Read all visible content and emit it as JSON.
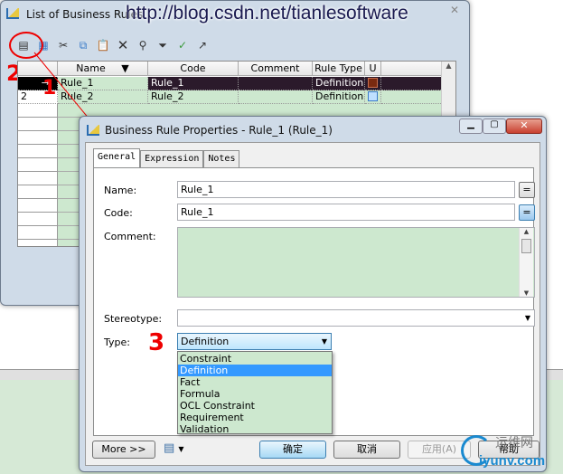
{
  "watermark": "http://blog.csdn.net/tianlesoftware",
  "watermark2": {
    "cn": "运维网",
    "url": "iyunv.com"
  },
  "annotations": [
    "2",
    "1",
    "3"
  ],
  "list_window": {
    "title": "List of Business Rules",
    "toolbar": [
      "properties-icon",
      "add-rows-icon",
      "cut-icon",
      "copy-icon",
      "paste-icon",
      "delete-icon",
      "find-icon",
      "filter-icon",
      "filter-check-icon",
      "shortcut-icon"
    ],
    "columns": [
      "Name",
      "Code",
      "Comment",
      "Rule Type",
      "U"
    ],
    "rows": [
      {
        "marker": "→",
        "name": "Rule_1",
        "code": "Rule_1",
        "comment": "",
        "rule_type": "Definition",
        "selected": true
      },
      {
        "marker": "2",
        "name": "Rule_2",
        "code": "Rule_2",
        "comment": "",
        "rule_type": "Definition",
        "selected": false
      }
    ]
  },
  "dialog": {
    "title": "Business Rule Properties - Rule_1 (Rule_1)",
    "tabs": [
      "General",
      "Expression",
      "Notes"
    ],
    "active_tab": "General",
    "fields": {
      "name_label": "Name:",
      "name_value": "Rule_1",
      "code_label": "Code:",
      "code_value": "Rule_1",
      "comment_label": "Comment:",
      "comment_value": "",
      "stereotype_label": "Stereotype:",
      "stereotype_value": "",
      "type_label": "Type:",
      "type_value": "Definition",
      "eq_label": "="
    },
    "type_options": [
      "Constraint",
      "Definition",
      "Fact",
      "Formula",
      "OCL Constraint",
      "Requirement",
      "Validation"
    ],
    "buttons": {
      "more": "More >>",
      "ok": "确定",
      "cancel": "取消",
      "apply": "应用(A)",
      "help": "帮助"
    },
    "colors": {
      "selection": "#3399ff",
      "field_green": "#cde8cf",
      "selected_row": "#2b1a2b"
    }
  }
}
